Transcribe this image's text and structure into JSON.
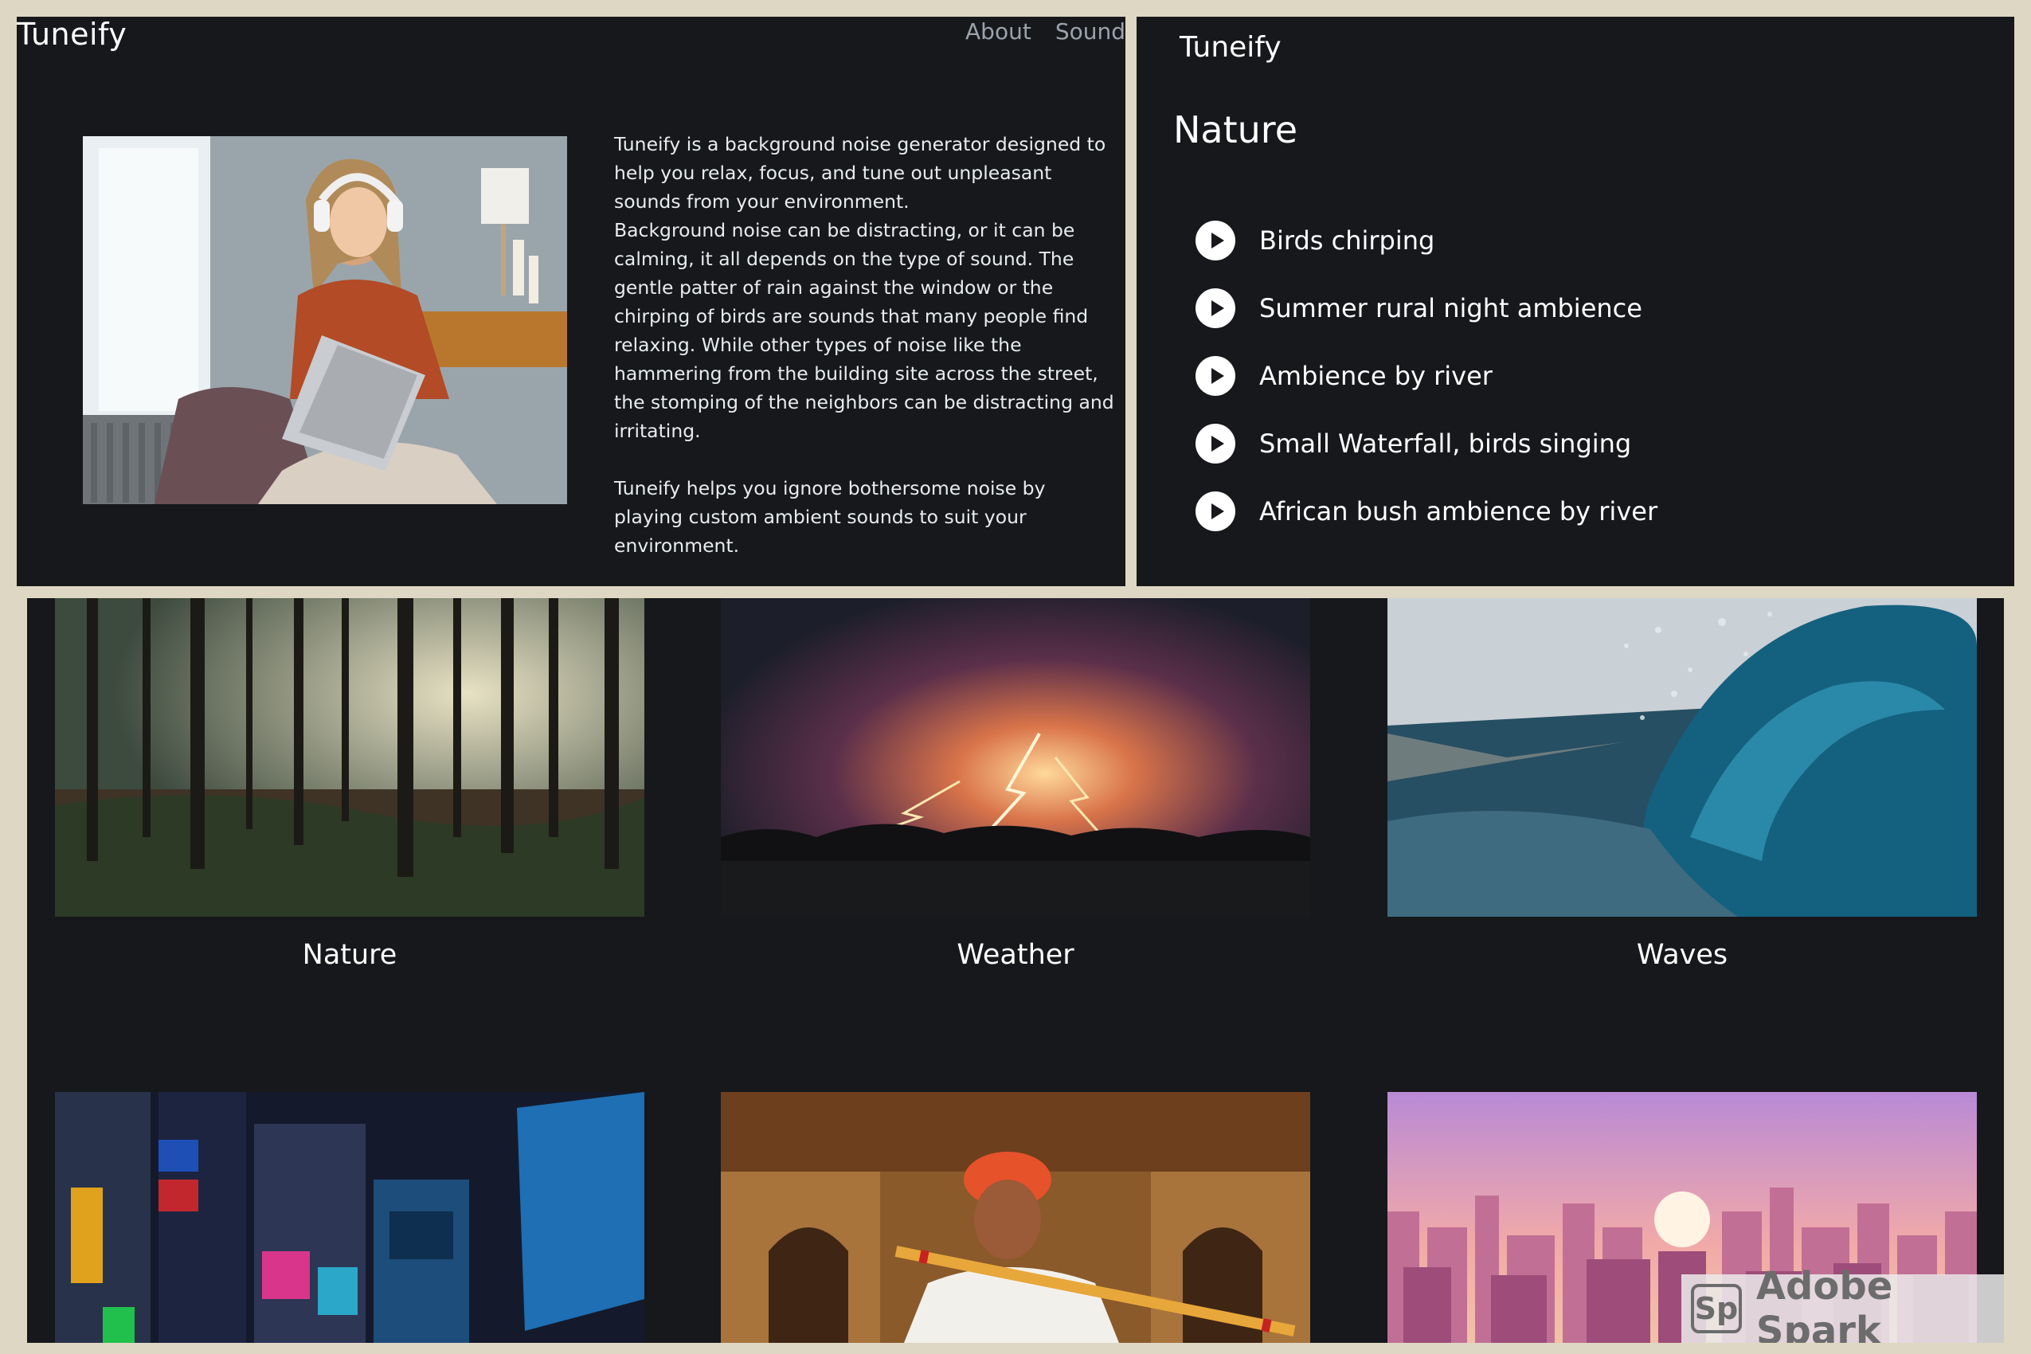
{
  "about_page": {
    "brand": "Tuneify",
    "nav": [
      "About",
      "Sound"
    ],
    "paragraphs": [
      "Tuneify is a background noise generator designed to help you relax, focus, and tune out unpleasant sounds from your environment.",
      "Background noise can be distracting, or it can be calming, it all depends on the type of sound. The gentle patter of rain against the window or the chirping of birds are sounds that many people find relaxing. While other types of noise like the hammering from the building site across the street, the stomping of the neighbors can be distracting and irritating.",
      "Tuneify helps you ignore bothersome noise by playing custom ambient sounds to suit your environment."
    ]
  },
  "sounds_page": {
    "brand": "Tuneify",
    "title": "Nature",
    "sounds": [
      "Birds chirping",
      "Summer rural night ambience",
      "Ambience by river",
      "Small Waterfall, birds singing",
      "African bush ambience by river"
    ]
  },
  "gallery": {
    "cards": [
      "Nature",
      "Weather",
      "Waves"
    ]
  },
  "watermark": {
    "badge": "Sp",
    "text": "Adobe Spark"
  }
}
